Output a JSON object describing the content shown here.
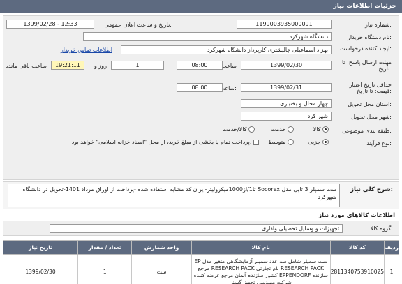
{
  "header": {
    "title": "جزئیات اطلاعات نیاز"
  },
  "fields": {
    "need_number_label": "شماره نیاز:",
    "need_number": "1199003935000091",
    "announce_label": "تاریخ و ساعت اعلان عمومی:",
    "announce_value": "1399/02/28 - 12:33",
    "buyer_org_label": "نام دستگاه خریدار:",
    "buyer_org": "دانشگاه شهرکرد",
    "creator_label": "ایجاد کننده درخواست:",
    "creator": "بهزاد اسماعیلی چالیشتری کارپرداز دانشگاه شهرکرد",
    "contact_link": "اطلاعات تماس خریدار",
    "reply_deadline_label": "مهلت ارسال پاسخ: تا تاریخ:",
    "reply_date": "1399/02/30",
    "time_label": "ساعت",
    "reply_time": "08:00",
    "day_count": "1",
    "day_label": "روز و",
    "remaining_time": "19:21:11",
    "remaining_label": "ساعت باقی مانده",
    "validity_label": "حداقل تاریخ اعتبار قیمت: تا تاریخ:",
    "validity_date": "1399/02/31",
    "validity_time_label": "ساعت:",
    "validity_time": "08:00",
    "province_label": "استان محل تحویل:",
    "province": "چهار محال و بختیاری",
    "city_label": "شهر محل تحویل:",
    "city": "شهر کرد",
    "category_label": "طبقه بندی موضوعی:",
    "category_options": [
      "کالا",
      "خدمت",
      "کالا/خدمت"
    ],
    "payment_label": "نوع فرآیند:",
    "process_options": [
      "جزیی",
      "متوسط"
    ],
    "payment_note": "پرداخت تمام یا بخشی از مبلغ خرید، از محل \"اسناد خزانه اسلامی\" خواهد بود."
  },
  "description": {
    "label": "شرح کلی نیاز:",
    "text": "ست سمپلر 3 تایی مدل Socorex تا1/از1000میکرولیتر-ایران کد مشابه استفاده شده -پرداخت از اوراق مرداد 1401-تحویل در دانشگاه شهرکرد"
  },
  "goods_section": {
    "title": "اطلاعات کالاهای مورد نیاز",
    "group_label": "گروه کالا:",
    "group_value": "تجهیزات و وسایل تحصیلی واداری"
  },
  "table": {
    "headers": [
      "ردیف",
      "کد کالا",
      "نام کالا",
      "واحد شمارش",
      "تعداد / مقدار",
      "تاریخ نیاز"
    ],
    "rows": [
      {
        "index": "1",
        "code": "2811340753910025",
        "name": "ست سمپلر شامل سه عدد سمپلر آزمایشگاهی متغیر مدل EP RESEARCH PACK نام تجارتی RESEARCH PACK مرجع سازنده EPPENDORF کشور سازنده آلمان مرجع عرضه کننده شرکت مهندسی تجهیز گستر",
        "unit": "ست",
        "qty": "1",
        "date": "1399/02/30"
      }
    ]
  }
}
